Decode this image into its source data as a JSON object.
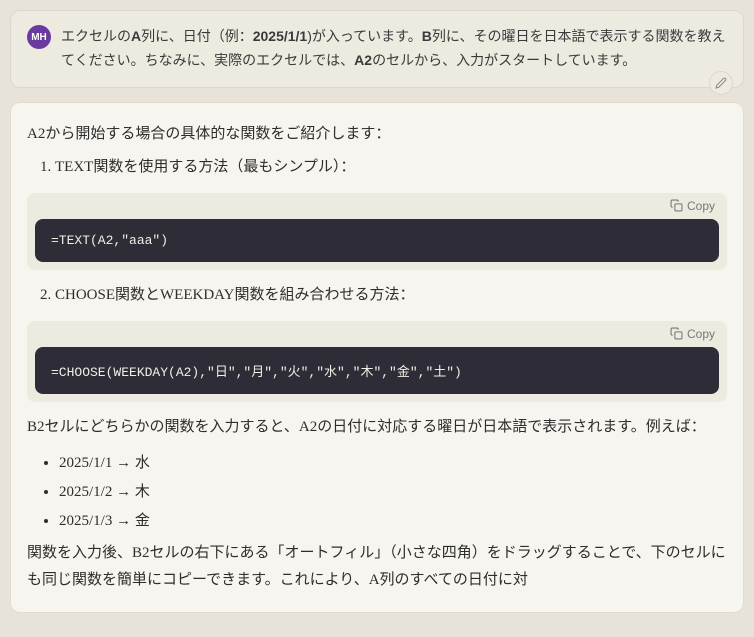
{
  "user": {
    "avatar_initials": "MH",
    "message_prefix": "エクセルの",
    "bold1": "A",
    "mid1": "列に、日付（例：",
    "bold2": "2025/1/1",
    "mid2": ")が入っています。",
    "bold3": "B",
    "mid3": "列に、その曜日を日本語で表示する関数を教えてください。ちなみに、実際のエクセルでは、",
    "bold4": "A2",
    "suffix": "のセルから、入力がスタートしています。"
  },
  "assistant": {
    "intro": "A2から開始する場合の具体的な関数をご紹介します：",
    "method1": "TEXT関数を使用する方法（最もシンプル）：",
    "method2": "CHOOSE関数とWEEKDAY関数を組み合わせる方法：",
    "explain1": "B2セルにどちらかの関数を入力すると、A2の日付に対応する曜日が日本語で表示されます。例えば：",
    "examples": [
      "2025/1/1 → 水",
      "2025/1/2 → 木",
      "2025/1/3 → 金"
    ],
    "footer": "関数を入力後、B2セルの右下にある「オートフィル」（小さな四角）をドラッグすることで、下のセルにも同じ関数を簡単にコピーできます。これにより、A列のすべての日付に対"
  },
  "code": {
    "copy_label": "Copy",
    "block1": "=TEXT(A2,\"aaa\")",
    "block2": "=CHOOSE(WEEKDAY(A2),\"日\",\"月\",\"火\",\"水\",\"木\",\"金\",\"土\")"
  }
}
